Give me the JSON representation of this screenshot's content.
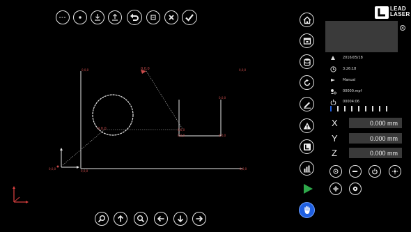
{
  "brand": {
    "line1": "LEAD",
    "line2": "LASER"
  },
  "info": {
    "date": "2016/05/18",
    "time": "3:26:18",
    "mode": "Manual",
    "program": "00000.mpf",
    "state": "00004:06"
  },
  "axes": [
    {
      "label": "X",
      "value": "0.000 mm"
    },
    {
      "label": "Y",
      "value": "0.000 mm"
    },
    {
      "label": "Z",
      "value": "0.000 mm"
    }
  ],
  "canvas": {
    "labels": {
      "origin": "0,0,0",
      "origin_right": "0,0,0",
      "corner_tl": "0,0,0",
      "top_mid": "0,0,0",
      "top_right": "0,0,0",
      "circle_pt": "0,0,0",
      "rect_bl": "0,0,0",
      "rect_br": "0,0,0",
      "rect_tr": "0,0,0",
      "rect_bottom_a": "0,0,0",
      "rect_bottom_b": "0,0,0"
    }
  },
  "colors": {
    "accent_blue": "#1f5fe0",
    "play_green": "#2ea84a",
    "canvas_label": "#c94b4b",
    "field_bg": "#3a3a3a"
  },
  "icons": {
    "top": [
      "dashed-circle-icon",
      "dot-circle-icon",
      "download-icon",
      "upload-icon",
      "undo-icon",
      "stop-icon",
      "close-icon",
      "check-icon"
    ],
    "bottom": [
      "zoom-in-icon",
      "arrow-up-icon",
      "zoom-out-icon",
      "arrow-left-icon",
      "arrow-down-icon",
      "arrow-right-icon"
    ],
    "side": [
      "home-icon",
      "window-icon",
      "database-icon",
      "refresh-icon",
      "edit-icon",
      "warning-icon",
      "logo-icon",
      "chart-icon",
      "play-icon",
      "hand-icon"
    ]
  }
}
